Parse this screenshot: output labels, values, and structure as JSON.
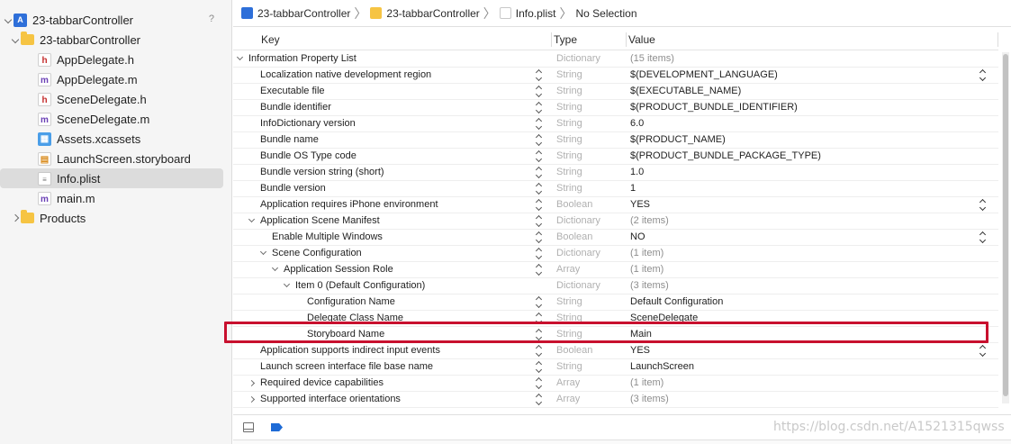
{
  "navigator": {
    "project": {
      "label": "23-tabbarController",
      "help": "?"
    },
    "group": {
      "label": "23-tabbarController"
    },
    "files": [
      {
        "label": "AppDelegate.h",
        "kind": "h"
      },
      {
        "label": "AppDelegate.m",
        "kind": "m"
      },
      {
        "label": "SceneDelegate.h",
        "kind": "h"
      },
      {
        "label": "SceneDelegate.m",
        "kind": "m"
      },
      {
        "label": "Assets.xcassets",
        "kind": "assets"
      },
      {
        "label": "LaunchScreen.storyboard",
        "kind": "storyboard"
      },
      {
        "label": "Info.plist",
        "kind": "plist",
        "selected": true
      },
      {
        "label": "main.m",
        "kind": "m"
      }
    ],
    "products": {
      "label": "Products"
    }
  },
  "jumpbar": {
    "items": [
      "23-tabbarController",
      "23-tabbarController",
      "Info.plist",
      "No Selection"
    ]
  },
  "columns": {
    "key": "Key",
    "type": "Type",
    "value": "Value"
  },
  "plist": {
    "rows": [
      {
        "key": "Information Property List",
        "type": "Dictionary",
        "value": "(15 items)",
        "level": 0,
        "disc": "open",
        "muted": true,
        "stepper": false
      },
      {
        "key": "Localization native development region",
        "type": "String",
        "value": "$(DEVELOPMENT_LANGUAGE)",
        "level": 1,
        "stepper": true,
        "valStepper": true
      },
      {
        "key": "Executable file",
        "type": "String",
        "value": "$(EXECUTABLE_NAME)",
        "level": 1,
        "stepper": true
      },
      {
        "key": "Bundle identifier",
        "type": "String",
        "value": "$(PRODUCT_BUNDLE_IDENTIFIER)",
        "level": 1,
        "stepper": true
      },
      {
        "key": "InfoDictionary version",
        "type": "String",
        "value": "6.0",
        "level": 1,
        "stepper": true
      },
      {
        "key": "Bundle name",
        "type": "String",
        "value": "$(PRODUCT_NAME)",
        "level": 1,
        "stepper": true
      },
      {
        "key": "Bundle OS Type code",
        "type": "String",
        "value": "$(PRODUCT_BUNDLE_PACKAGE_TYPE)",
        "level": 1,
        "stepper": true
      },
      {
        "key": "Bundle version string (short)",
        "type": "String",
        "value": "1.0",
        "level": 1,
        "stepper": true
      },
      {
        "key": "Bundle version",
        "type": "String",
        "value": "1",
        "level": 1,
        "stepper": true
      },
      {
        "key": "Application requires iPhone environment",
        "type": "Boolean",
        "value": "YES",
        "level": 1,
        "stepper": true,
        "valStepper": true
      },
      {
        "key": "Application Scene Manifest",
        "type": "Dictionary",
        "value": "(2 items)",
        "level": 1,
        "disc": "open",
        "muted": true,
        "stepper": true
      },
      {
        "key": "Enable Multiple Windows",
        "type": "Boolean",
        "value": "NO",
        "level": 2,
        "stepper": true,
        "valStepper": true
      },
      {
        "key": "Scene Configuration",
        "type": "Dictionary",
        "value": "(1 item)",
        "level": 2,
        "disc": "open",
        "muted": true,
        "stepper": true
      },
      {
        "key": "Application Session Role",
        "type": "Array",
        "value": "(1 item)",
        "level": 3,
        "disc": "open",
        "muted": true,
        "stepper": true
      },
      {
        "key": "Item 0 (Default Configuration)",
        "type": "Dictionary",
        "value": "(3 items)",
        "level": 4,
        "disc": "open",
        "muted": true,
        "stepper": false
      },
      {
        "key": "Configuration Name",
        "type": "String",
        "value": "Default Configuration",
        "level": 5,
        "stepper": true
      },
      {
        "key": "Delegate Class Name",
        "type": "String",
        "value": "SceneDelegate",
        "level": 5,
        "stepper": true
      },
      {
        "key": "Storyboard Name",
        "type": "String",
        "value": "Main",
        "level": 5,
        "stepper": true,
        "highlighted": true
      },
      {
        "key": "Application supports indirect input events",
        "type": "Boolean",
        "value": "YES",
        "level": 1,
        "stepper": true,
        "valStepper": true
      },
      {
        "key": "Launch screen interface file base name",
        "type": "String",
        "value": "LaunchScreen",
        "level": 1,
        "stepper": true
      },
      {
        "key": "Required device capabilities",
        "type": "Array",
        "value": "(1 item)",
        "level": 1,
        "disc": "closed",
        "muted": true,
        "stepper": true
      },
      {
        "key": "Supported interface orientations",
        "type": "Array",
        "value": "(3 items)",
        "level": 1,
        "disc": "closed",
        "muted": true,
        "stepper": true
      }
    ]
  },
  "watermark": "https://blog.csdn.net/A1521315qwss",
  "colors": {
    "highlight": "#c8102e",
    "selection": "#dcdcdc",
    "accent": "#1e6bd6"
  }
}
